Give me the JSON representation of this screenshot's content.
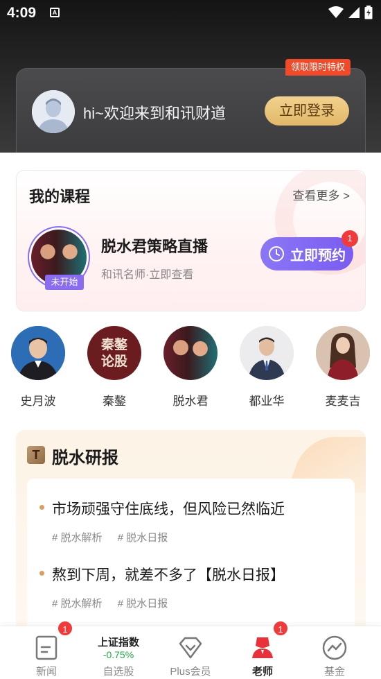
{
  "status_bar": {
    "time": "4:09",
    "notification_icon": "A"
  },
  "header": {
    "welcome_text": "hi~欢迎来到和讯财道",
    "login_button": "立即登录",
    "privilege_tag": "领取限时特权"
  },
  "my_course": {
    "title": "我的课程",
    "see_more": "查看更多 >",
    "item": {
      "status": "未开始",
      "title": "脱水君策略直播",
      "subtitle": "和讯名师·立即查看",
      "book_button": "立即预约",
      "badge": "1"
    }
  },
  "teachers": [
    {
      "name": "史月波"
    },
    {
      "name": "秦鏊",
      "avatar_text": "秦鏊 论股"
    },
    {
      "name": "脱水君"
    },
    {
      "name": "都业华"
    },
    {
      "name": "麦麦吉"
    }
  ],
  "research": {
    "logo": "T",
    "title": "脱水研报",
    "articles": [
      {
        "title": "市场顽强守住底线，但风险已然临近",
        "tags": [
          "# 脱水解析",
          "# 脱水日报"
        ]
      },
      {
        "title": "熬到下周，就差不多了【脱水日报】",
        "tags": [
          "# 脱水解析",
          "# 脱水日报"
        ]
      }
    ]
  },
  "bottom_nav": {
    "items": [
      {
        "label": "新闻",
        "icon": "news-icon",
        "badge": "1"
      },
      {
        "label": "自选股",
        "index_name": "上证指数",
        "index_change": "-0.75%"
      },
      {
        "label": "Plus会员",
        "icon": "diamond-icon"
      },
      {
        "label": "老师",
        "icon": "teacher-icon",
        "badge": "1",
        "active": true
      },
      {
        "label": "基金",
        "icon": "fund-icon"
      }
    ]
  },
  "colors": {
    "accent_purple": "#7b5cf0",
    "badge_red": "#ef3b3b",
    "gold": "#e2b768",
    "active_red": "#e8313a",
    "index_green": "#20a84a"
  }
}
